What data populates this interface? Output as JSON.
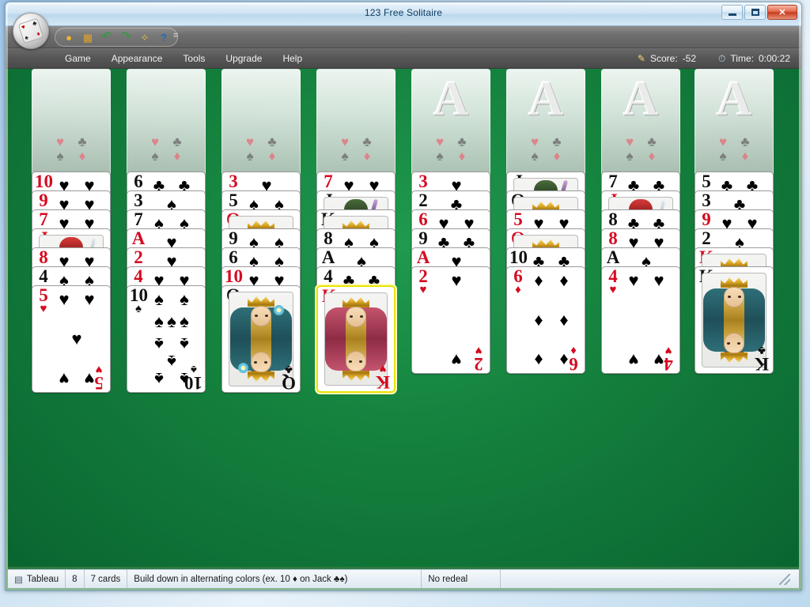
{
  "window": {
    "title": "123 Free Solitaire",
    "controls": {
      "minimize": "minimize-button",
      "maximize": "maximize-button",
      "close": "✕"
    }
  },
  "toolbar": {
    "buttons": [
      {
        "name": "new-game-icon",
        "glyph": "●",
        "color": "#f0b429"
      },
      {
        "name": "open-game-icon",
        "glyph": "▮",
        "color": "#e0a228"
      },
      {
        "name": "undo-icon",
        "glyph": "↶",
        "color": "#2e9b3f"
      },
      {
        "name": "redo-icon",
        "glyph": "↷",
        "color": "#2e9b3f"
      },
      {
        "name": "hint-wand-icon",
        "glyph": "✧",
        "color": "#e8c23a"
      },
      {
        "name": "help-icon",
        "glyph": "?",
        "color": "#1a6fc4"
      }
    ],
    "overflow_chevron": "≡"
  },
  "menubar": {
    "items": [
      "Game",
      "Appearance",
      "Tools",
      "Upgrade",
      "Help"
    ],
    "score_icon": "✎",
    "score_label": "Score:",
    "score_value": "-52",
    "time_icon": "⏱",
    "time_label": "Time:",
    "time_value": "0:00:22"
  },
  "board": {
    "slot_suits": [
      "♥",
      "♣",
      "♠",
      "♦"
    ],
    "freecells": [
      {
        "name": "freecell-1",
        "empty": true
      },
      {
        "name": "freecell-2",
        "empty": true
      },
      {
        "name": "freecell-3",
        "empty": true
      },
      {
        "name": "freecell-4",
        "empty": true
      }
    ],
    "foundations": [
      {
        "name": "foundation-1",
        "watermark": "A",
        "empty": true
      },
      {
        "name": "foundation-2",
        "watermark": "A",
        "empty": true
      },
      {
        "name": "foundation-3",
        "watermark": "A",
        "empty": true
      },
      {
        "name": "foundation-4",
        "watermark": "A",
        "empty": true
      }
    ],
    "columns": [
      {
        "name": "tableau-column-1",
        "cards": [
          {
            "rank": "10",
            "suit": "♥",
            "color": "red",
            "art": "pips"
          },
          {
            "rank": "9",
            "suit": "♥",
            "color": "red",
            "art": "pips"
          },
          {
            "rank": "7",
            "suit": "♥",
            "color": "red",
            "art": "pips"
          },
          {
            "rank": "J",
            "suit": "♦",
            "color": "red",
            "art": "jack-red"
          },
          {
            "rank": "8",
            "suit": "♥",
            "color": "red",
            "art": "pips"
          },
          {
            "rank": "4",
            "suit": "♠",
            "color": "black",
            "art": "pips"
          },
          {
            "rank": "5",
            "suit": "♥",
            "color": "red",
            "art": "pips",
            "top": true
          }
        ]
      },
      {
        "name": "tableau-column-2",
        "cards": [
          {
            "rank": "6",
            "suit": "♣",
            "color": "black",
            "art": "pips"
          },
          {
            "rank": "3",
            "suit": "♠",
            "color": "black",
            "art": "pips"
          },
          {
            "rank": "7",
            "suit": "♠",
            "color": "black",
            "art": "pips"
          },
          {
            "rank": "A",
            "suit": "♥",
            "color": "red",
            "art": "pips"
          },
          {
            "rank": "2",
            "suit": "♥",
            "color": "red",
            "art": "pips"
          },
          {
            "rank": "4",
            "suit": "♥",
            "color": "red",
            "art": "pips"
          },
          {
            "rank": "10",
            "suit": "♠",
            "color": "black",
            "art": "pips",
            "top": true
          }
        ]
      },
      {
        "name": "tableau-column-3",
        "cards": [
          {
            "rank": "3",
            "suit": "♥",
            "color": "red",
            "art": "pips"
          },
          {
            "rank": "5",
            "suit": "♠",
            "color": "black",
            "art": "pips"
          },
          {
            "rank": "Q",
            "suit": "♦",
            "color": "red",
            "art": "queen-red"
          },
          {
            "rank": "9",
            "suit": "♠",
            "color": "black",
            "art": "pips"
          },
          {
            "rank": "6",
            "suit": "♠",
            "color": "black",
            "art": "pips"
          },
          {
            "rank": "10",
            "suit": "♥",
            "color": "red",
            "art": "pips"
          },
          {
            "rank": "Q",
            "suit": "♣",
            "color": "black",
            "art": "queen-black",
            "top": true
          }
        ]
      },
      {
        "name": "tableau-column-4",
        "cards": [
          {
            "rank": "7",
            "suit": "♥",
            "color": "red",
            "art": "pips"
          },
          {
            "rank": "J",
            "suit": "♣",
            "color": "black",
            "art": "jack-green"
          },
          {
            "rank": "K",
            "suit": "♠",
            "color": "black",
            "art": "king-black"
          },
          {
            "rank": "8",
            "suit": "♠",
            "color": "black",
            "art": "pips"
          },
          {
            "rank": "A",
            "suit": "♠",
            "color": "black",
            "art": "pips"
          },
          {
            "rank": "4",
            "suit": "♣",
            "color": "black",
            "art": "pips"
          },
          {
            "rank": "K",
            "suit": "♥",
            "color": "red",
            "art": "king-red",
            "top": true,
            "selected": true
          }
        ]
      },
      {
        "name": "tableau-column-5",
        "cards": [
          {
            "rank": "3",
            "suit": "♥",
            "color": "red",
            "art": "pips"
          },
          {
            "rank": "2",
            "suit": "♣",
            "color": "black",
            "art": "pips"
          },
          {
            "rank": "6",
            "suit": "♥",
            "color": "red",
            "art": "pips"
          },
          {
            "rank": "9",
            "suit": "♣",
            "color": "black",
            "art": "pips"
          },
          {
            "rank": "A",
            "suit": "♥",
            "color": "red",
            "art": "pips"
          },
          {
            "rank": "2",
            "suit": "♥",
            "color": "red",
            "art": "pips",
            "top": true
          }
        ]
      },
      {
        "name": "tableau-column-6",
        "cards": [
          {
            "rank": "J",
            "suit": "♠",
            "color": "black",
            "art": "jack-navy"
          },
          {
            "rank": "Q",
            "suit": "♠",
            "color": "black",
            "art": "queen-black"
          },
          {
            "rank": "5",
            "suit": "♥",
            "color": "red",
            "art": "pips"
          },
          {
            "rank": "Q",
            "suit": "♥",
            "color": "red",
            "art": "queen-red"
          },
          {
            "rank": "10",
            "suit": "♣",
            "color": "black",
            "art": "pips"
          },
          {
            "rank": "6",
            "suit": "♦",
            "color": "red",
            "art": "pips",
            "top": true
          }
        ]
      },
      {
        "name": "tableau-column-7",
        "cards": [
          {
            "rank": "7",
            "suit": "♣",
            "color": "black",
            "art": "pips"
          },
          {
            "rank": "J",
            "suit": "♥",
            "color": "red",
            "art": "jack-red"
          },
          {
            "rank": "8",
            "suit": "♣",
            "color": "black",
            "art": "pips"
          },
          {
            "rank": "8",
            "suit": "♥",
            "color": "red",
            "art": "pips"
          },
          {
            "rank": "A",
            "suit": "♠",
            "color": "black",
            "art": "pips"
          },
          {
            "rank": "4",
            "suit": "♥",
            "color": "red",
            "art": "pips",
            "top": true
          }
        ]
      },
      {
        "name": "tableau-column-8",
        "cards": [
          {
            "rank": "5",
            "suit": "♣",
            "color": "black",
            "art": "pips"
          },
          {
            "rank": "3",
            "suit": "♣",
            "color": "black",
            "art": "pips"
          },
          {
            "rank": "9",
            "suit": "♥",
            "color": "red",
            "art": "pips"
          },
          {
            "rank": "2",
            "suit": "♠",
            "color": "black",
            "art": "pips"
          },
          {
            "rank": "K",
            "suit": "♦",
            "color": "red",
            "art": "king-red"
          },
          {
            "rank": "K",
            "suit": "♣",
            "color": "black",
            "art": "king-black",
            "top": true
          }
        ]
      }
    ]
  },
  "statusbar": {
    "pile_icon": "▤",
    "pile_name": "Tableau",
    "pile_index": "8",
    "card_count": "7 cards",
    "rule": "Build down in alternating colors (ex. 10 ♦ on Jack ♣♠)",
    "redeal": "No redeal"
  }
}
